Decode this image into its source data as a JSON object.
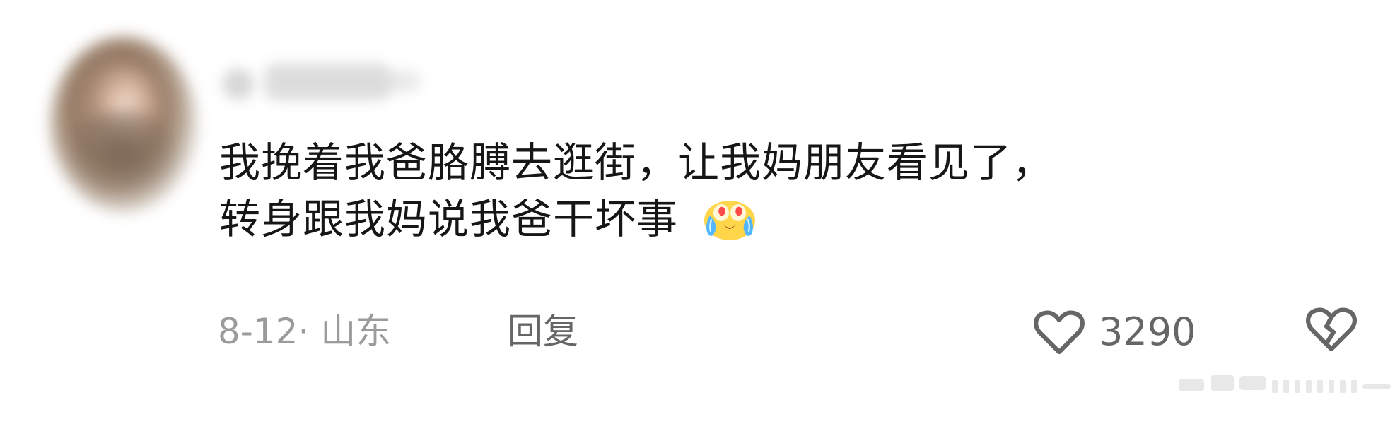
{
  "comment": {
    "text_line_1": "我挽着我爸胳膊去逛街，让我妈朋友看见了，",
    "text_line_2": "转身跟我妈说我爸干坏事",
    "emoji": "crying-laughing-emoji"
  },
  "meta": {
    "date_location": "8-12· 山东",
    "reply_label": "回复"
  },
  "actions": {
    "like_icon": "heart-icon",
    "like_count": "3290",
    "dislike_icon": "broken-heart-icon"
  },
  "colors": {
    "text": "#161616",
    "meta_text": "#9b9b9b",
    "action_text": "#666666",
    "emoji_yellow": "#ffd54a",
    "emoji_blue": "#51b7ff"
  }
}
